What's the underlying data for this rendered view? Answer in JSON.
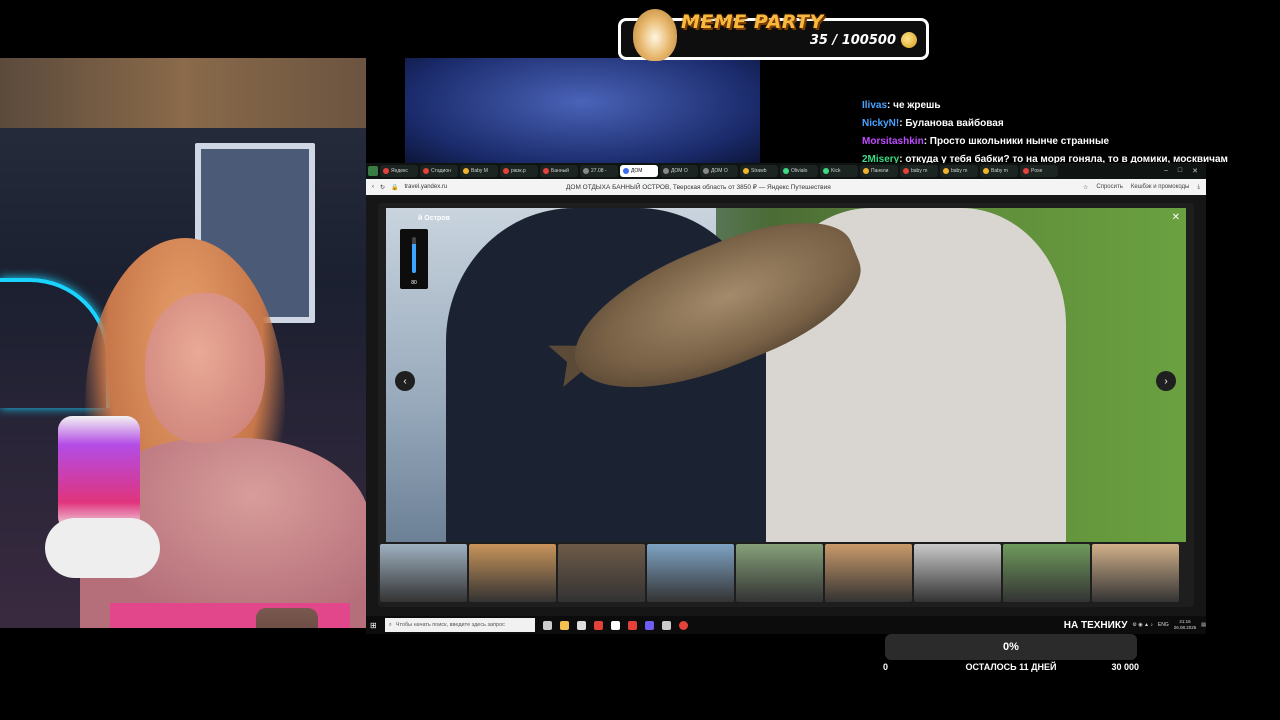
{
  "meme_party": {
    "title": "MEME PARTY",
    "score": "35 / 100500"
  },
  "chat": [
    {
      "user": "Ilivas",
      "color": "#4aa3ff",
      "text": ": че жрешь"
    },
    {
      "user": "NickyN!",
      "color": "#4aa3ff",
      "text": ": Буланова вайбовая"
    },
    {
      "user": "Morsitashkin",
      "color": "#c04cff",
      "text": ": Просто школьники нынче странные"
    },
    {
      "user": "2Misery",
      "color": "#3ddc84",
      "text": ": откуда у тебя бабки? то на моря гоняла, то в домики, москвичам"
    }
  ],
  "browser": {
    "tabs": [
      {
        "label": "Яндекс",
        "color": "#e5413b",
        "active": false
      },
      {
        "label": "Стадион",
        "color": "#e5413b",
        "active": false
      },
      {
        "label": "Baby M",
        "color": "#f1b32c",
        "active": false
      },
      {
        "label": "ржзк.р",
        "color": "#e5413b",
        "active": false
      },
      {
        "label": "Банный",
        "color": "#e5413b",
        "active": false
      },
      {
        "label": "27.08 -",
        "color": "#888888",
        "active": false
      },
      {
        "label": "ДОМ",
        "color": "#3a6cf4",
        "active": true
      },
      {
        "label": "ДОМ О",
        "color": "#888888",
        "active": false
      },
      {
        "label": "ДОМ О",
        "color": "#888888",
        "active": false
      },
      {
        "label": "Strawb",
        "color": "#f1b32c",
        "active": false
      },
      {
        "label": "Olivialo",
        "color": "#3ddc84",
        "active": false
      },
      {
        "label": "Kick",
        "color": "#3ddc84",
        "active": false
      },
      {
        "label": "Панели",
        "color": "#f1b32c",
        "active": false
      },
      {
        "label": "baby m",
        "color": "#e5413b",
        "active": false
      },
      {
        "label": "baby m",
        "color": "#f1b32c",
        "active": false
      },
      {
        "label": "Baby m",
        "color": "#f1b32c",
        "active": false
      },
      {
        "label": "Рose",
        "color": "#e5413b",
        "active": false
      }
    ],
    "url": "travel.yandex.ru",
    "page_title": "ДОМ ОТДЫХА БАННЫЙ ОСТРОВ, Тверская область от 3850 ₽ — Яндекс Путешествия",
    "ext_1": "Спросить",
    "ext_2": "Кешбэк и промокоды",
    "photo_title": "й Остров",
    "volume": {
      "value": "80",
      "level": 0.8
    },
    "thumbs": [
      "#9fb1c1",
      "#c8945a",
      "#6e5a48",
      "#7fa3c4",
      "#86a07a",
      "#c99a6a",
      "#c9c9c9",
      "#6f9a5c",
      "#d1b08a"
    ],
    "search_placeholder": "Чтобы начать поиск, введите здесь запрос",
    "taskbar_label": "НА ТЕХНИКУ",
    "lang": "ENG",
    "time": "21:16",
    "date": "26.08.2025"
  },
  "goal": {
    "percent_label": "0%",
    "percent": 0,
    "min": "0",
    "middle": "ОСТАЛОСЬ 11 ДНЕЙ",
    "max": "30 000"
  }
}
